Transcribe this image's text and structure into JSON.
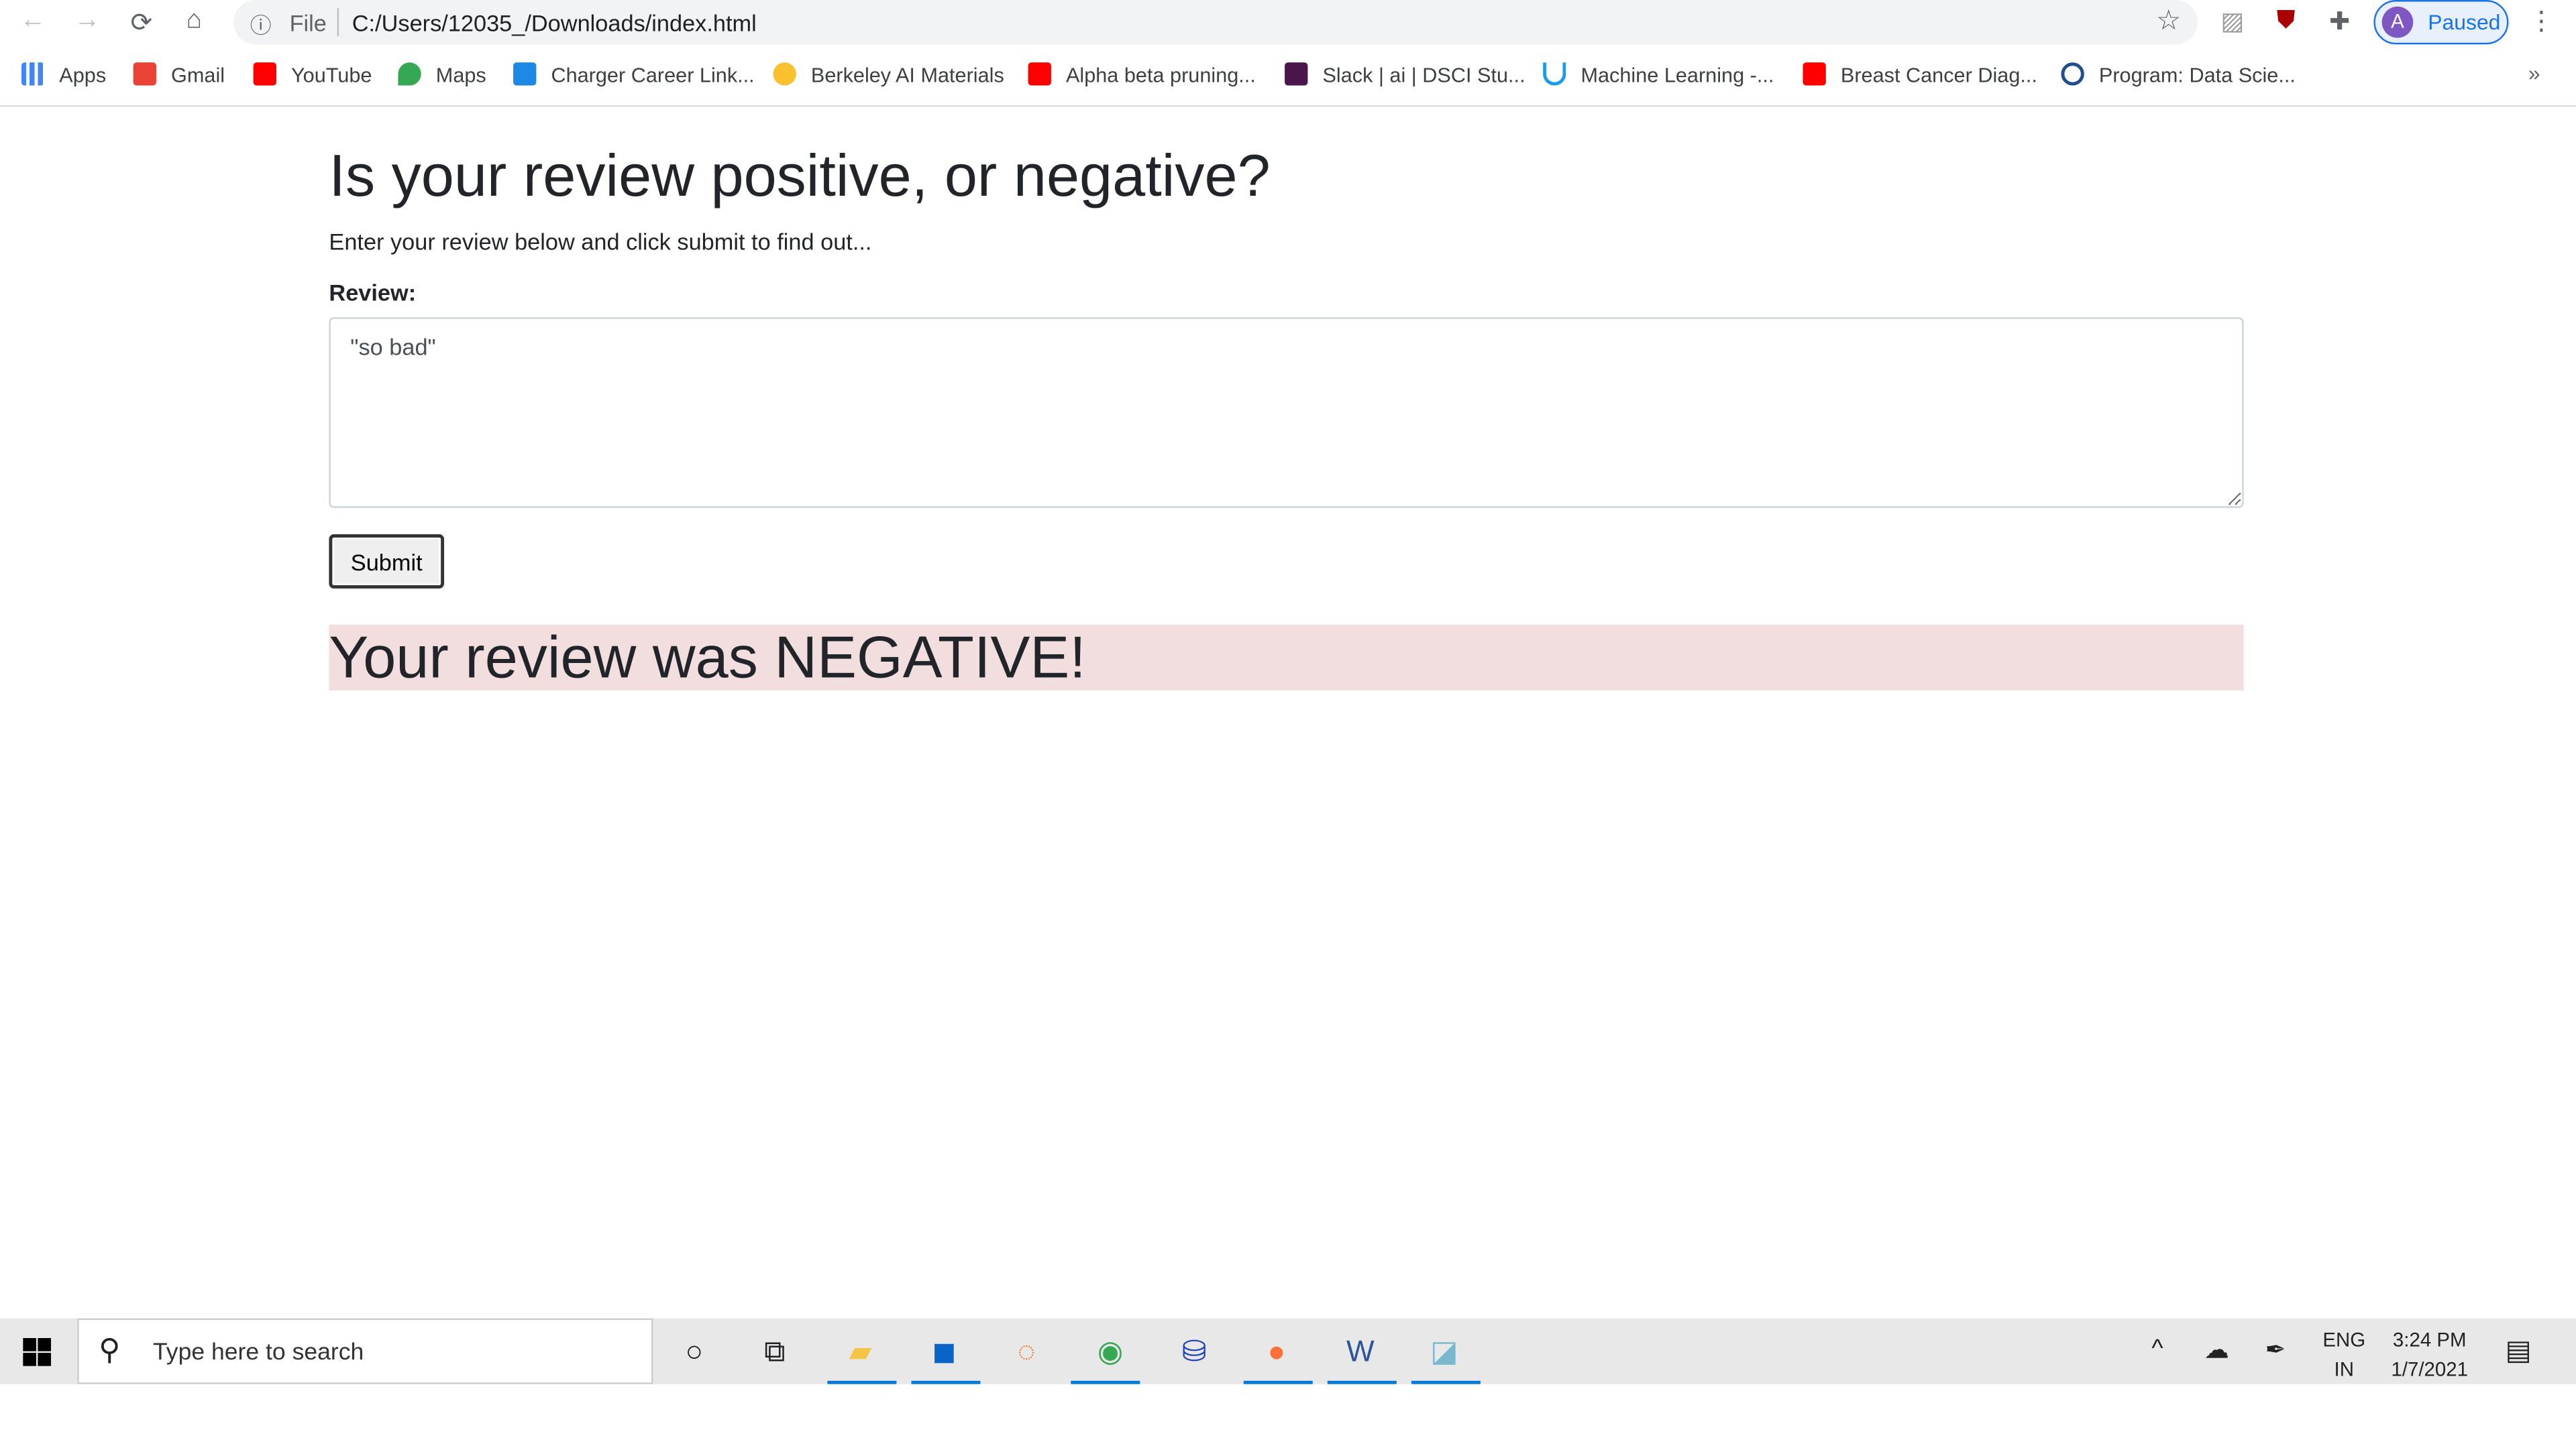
{
  "browser": {
    "url_scheme_label": "File",
    "url": "C:/Users/12035_/Downloads/index.html",
    "profile_initial": "A",
    "profile_status": "Paused",
    "bookmarks": [
      {
        "label": "Apps",
        "color": "#4285f4"
      },
      {
        "label": "Gmail",
        "color": "#ea4335"
      },
      {
        "label": "YouTube",
        "color": "#ff0000"
      },
      {
        "label": "Maps",
        "color": "#34a853"
      },
      {
        "label": "Charger Career Link...",
        "color": "#1e88e5"
      },
      {
        "label": "Berkeley AI Materials",
        "color": "#fbc02d"
      },
      {
        "label": "Alpha beta pruning...",
        "color": "#ff0000"
      },
      {
        "label": "Slack | ai | DSCI Stu...",
        "color": "#4a154b"
      },
      {
        "label": "Machine Learning -...",
        "color": "#1a9be6"
      },
      {
        "label": "Breast Cancer Diag...",
        "color": "#ff0000"
      },
      {
        "label": "Program: Data Scie...",
        "color": "#1f4e8c"
      }
    ]
  },
  "page": {
    "title": "Is your review positive, or negative?",
    "subtitle": "Enter your review below and click submit to find out...",
    "review_label": "Review:",
    "review_value": "\"so bad\"",
    "submit_label": "Submit",
    "result_text": "Your review was NEGATIVE!",
    "result_bg": "#f2dede"
  },
  "taskbar": {
    "search_placeholder": "Type here to search",
    "language": "ENG",
    "region": "IN",
    "time": "3:24 PM",
    "date": "1/7/2021"
  }
}
